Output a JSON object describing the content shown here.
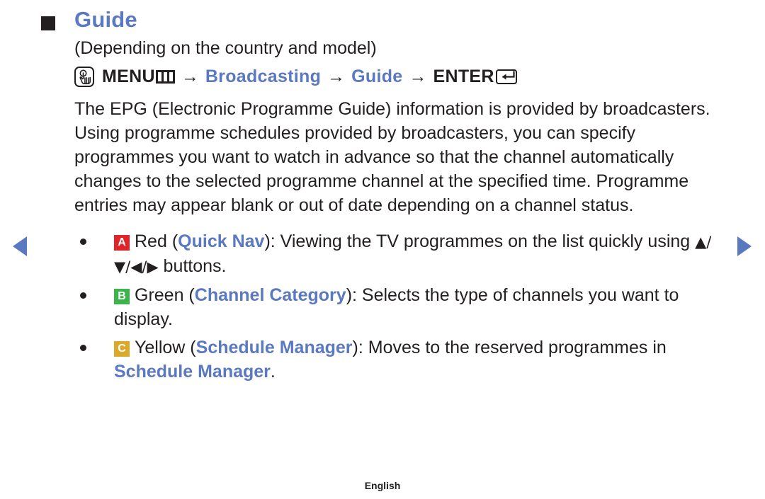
{
  "nav": {
    "prev_label": "◀",
    "next_label": "▶"
  },
  "heading": {
    "title": "Guide",
    "marker": "square-marker"
  },
  "subtitle": "(Depending on the country and model)",
  "path": {
    "menu_icon_name": "menu-hand-icon",
    "menu_label": "MENU",
    "menu_bars_icon_name": "menu-bars-icon",
    "arrow1": "→",
    "step1": "Broadcasting",
    "arrow2": "→",
    "step2": "Guide",
    "arrow3": "→",
    "enter_label": "ENTER",
    "enter_icon_name": "enter-return-icon"
  },
  "paragraph": "The EPG (Electronic Programme Guide) information is provided by broadcasters. Using programme schedules provided by broadcasters, you can specify programmes you want to watch in advance so that the channel automatically changes to the selected programme channel at the specified time. Programme entries may appear blank or out of date depending on a channel status.",
  "bullets": [
    {
      "badge": "A",
      "badge_color": "#e0242a",
      "color_name": "Red",
      "open_paren": " (",
      "feature": "Quick Nav",
      "close_paren": "): ",
      "text_before_keys": "Viewing the TV programmes on the list quickly using ",
      "keys": "▲/▼/◀/▶",
      "text_after_keys": " buttons."
    },
    {
      "badge": "B",
      "badge_color": "#3cb44b",
      "color_name": "Green",
      "open_paren": " (",
      "feature": "Channel Category",
      "close_paren": "): ",
      "text_before_keys": "Selects the type of channels you want to display.",
      "keys": "",
      "text_after_keys": ""
    },
    {
      "badge": "C",
      "badge_color": "#dcaa2a",
      "color_name": "Yellow",
      "open_paren": " (",
      "feature": "Schedule Manager",
      "close_paren": "): ",
      "text_before_keys": "Moves to the reserved programmes in ",
      "keys": "",
      "text_after_keys": "",
      "trailing_accent": "Schedule Manager",
      "trailing_period": "."
    }
  ],
  "footer": {
    "language": "English"
  },
  "colors": {
    "accent_blue": "#5b79c0",
    "text": "#231f20",
    "red": "#e0242a",
    "green": "#3cb44b",
    "yellow": "#dcaa2a"
  }
}
